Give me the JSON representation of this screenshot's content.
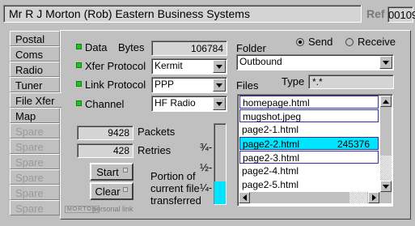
{
  "header": {
    "title": "Mr R J Morton (Rob)  Eastern Business Systems",
    "ref_label": "Ref",
    "ref_value": "00109"
  },
  "tabs": [
    {
      "label": "Postal",
      "state": "enabled"
    },
    {
      "label": "Coms",
      "state": "enabled"
    },
    {
      "label": "Radio",
      "state": "enabled"
    },
    {
      "label": "Tuner",
      "state": "enabled"
    },
    {
      "label": "File Xfer",
      "state": "active"
    },
    {
      "label": "Map",
      "state": "enabled"
    },
    {
      "label": "Spare",
      "state": "disabled"
    },
    {
      "label": "Spare",
      "state": "disabled"
    },
    {
      "label": "Spare",
      "state": "disabled"
    },
    {
      "label": "Spare",
      "state": "disabled"
    },
    {
      "label": "Spare",
      "state": "disabled"
    },
    {
      "label": "Spare",
      "state": "disabled"
    }
  ],
  "settings": {
    "data_label": "Data",
    "bytes_label": "Bytes",
    "bytes_value": "106784",
    "xfer_protocol_label": "Xfer Protocol",
    "xfer_protocol_value": "Kermit",
    "link_protocol_label": "Link Protocol",
    "link_protocol_value": "PPP",
    "channel_label": "Channel",
    "channel_value": "HF Radio",
    "led_color": "#22c022"
  },
  "counters": {
    "packets_value": "9428",
    "packets_label": "Packets",
    "retries_value": "428",
    "retries_label": "Retries"
  },
  "buttons": {
    "start": "Start",
    "clear": "Clear"
  },
  "progress": {
    "label_line1": "Portion of",
    "label_line2": "current file",
    "label_line3": "transferred",
    "tick_three_quarter": "¾-",
    "tick_half": "½-",
    "tick_quarter": "¼-",
    "fraction": 0.28,
    "fill_color": "#00e5ff"
  },
  "brand": {
    "logo": "MORTON",
    "tagline": "personal link"
  },
  "folder": {
    "label": "Folder",
    "value": "Outbound"
  },
  "direction": {
    "send_label": "Send",
    "receive_label": "Receive",
    "selected": "Send"
  },
  "files": {
    "label": "Files",
    "type_label": "Type",
    "type_value": "*.*",
    "items": [
      {
        "name": "homepage.html",
        "size": "",
        "style": "boxed"
      },
      {
        "name": "mugshot.jpeg",
        "size": "",
        "style": "boxed"
      },
      {
        "name": "page2-1.html",
        "size": "",
        "style": "plain"
      },
      {
        "name": "page2-2.html",
        "size": "245376",
        "style": "selected"
      },
      {
        "name": "page2-3.html",
        "size": "",
        "style": "boxed"
      },
      {
        "name": "page2-4.html",
        "size": "",
        "style": "plain"
      },
      {
        "name": "page2-5.html",
        "size": "",
        "style": "plain"
      }
    ]
  }
}
